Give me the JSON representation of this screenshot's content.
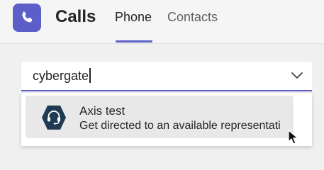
{
  "app": {
    "title": "Calls",
    "icon": "phone-icon",
    "accent_color": "#5b5fc7"
  },
  "tabs": [
    {
      "label": "Phone",
      "selected": true
    },
    {
      "label": "Contacts",
      "selected": false
    }
  ],
  "search": {
    "value": "cybergate",
    "dropdown_icon": "chevron-down-icon"
  },
  "results": [
    {
      "title": "Axis test",
      "subtitle": "Get directed to an available representati",
      "icon": "headset-icon"
    }
  ]
}
